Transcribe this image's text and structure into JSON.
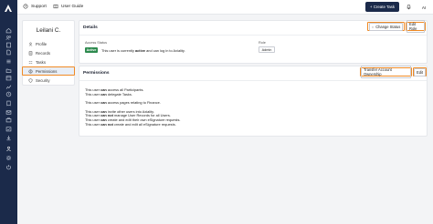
{
  "topbar": {
    "support_label": "Support",
    "user_guide_label": "User Guide",
    "create_task_label": "+ Create Task",
    "avatar_initials": "AI"
  },
  "rail": {
    "icons": [
      "home-icon",
      "users-icon",
      "document-icon",
      "file-icon",
      "list-icon",
      "folder-icon",
      "calendar-icon",
      "chart-icon",
      "clock-icon",
      "receipt-icon",
      "mail-icon",
      "briefcase-icon",
      "calendar-check-icon",
      "download-icon",
      "people-icon",
      "gear-icon",
      "power-icon"
    ]
  },
  "profile": {
    "name": "Leilani C.",
    "nav": [
      {
        "label": "Profile",
        "icon": "person-icon",
        "active": false
      },
      {
        "label": "Records",
        "icon": "records-icon",
        "active": false
      },
      {
        "label": "Tasks",
        "icon": "tasks-icon",
        "active": false
      },
      {
        "label": "Permissions",
        "icon": "permissions-icon",
        "active": true
      },
      {
        "label": "Security",
        "icon": "shield-icon",
        "active": false
      }
    ]
  },
  "details": {
    "title": "Details",
    "change_status_label": "Change Status",
    "edit_role_label": "Edit Role",
    "access_status_label": "Access Status",
    "status_badge": "Active",
    "access_text_prefix": "This user is currently",
    "access_text_bold": "active",
    "access_text_suffix": "and can log in to Axiality.",
    "role_label": "Role",
    "role_value": "Admin"
  },
  "permissions": {
    "title": "Permissions",
    "transfer_label": "Transfer Account Ownership",
    "edit_label": "Edit",
    "lines": [
      {
        "pre": "This user",
        "verb": "can",
        "post": "access all Participants.",
        "gap": false
      },
      {
        "pre": "This user",
        "verb": "can",
        "post": "delegate Tasks.",
        "gap": false
      },
      {
        "pre": "This user",
        "verb": "can",
        "post": "access pages relating to Finance.",
        "gap": true
      },
      {
        "pre": "This user",
        "verb": "can",
        "post": "invite other users into Axiality.",
        "gap": true
      },
      {
        "pre": "This user",
        "verb": "can not",
        "post": "manage User Records for all Users.",
        "gap": false
      },
      {
        "pre": "This user",
        "verb": "can",
        "post": "create and edit their own eSignature requests.",
        "gap": false
      },
      {
        "pre": "This user",
        "verb": "can not",
        "post": "create and edit all eSignature requests.",
        "gap": false
      }
    ]
  },
  "colors": {
    "rail": "#1b2a4a",
    "highlight": "#f08a24",
    "active_badge": "#2d8a4e",
    "nav_active_bg": "#e8eef7"
  }
}
